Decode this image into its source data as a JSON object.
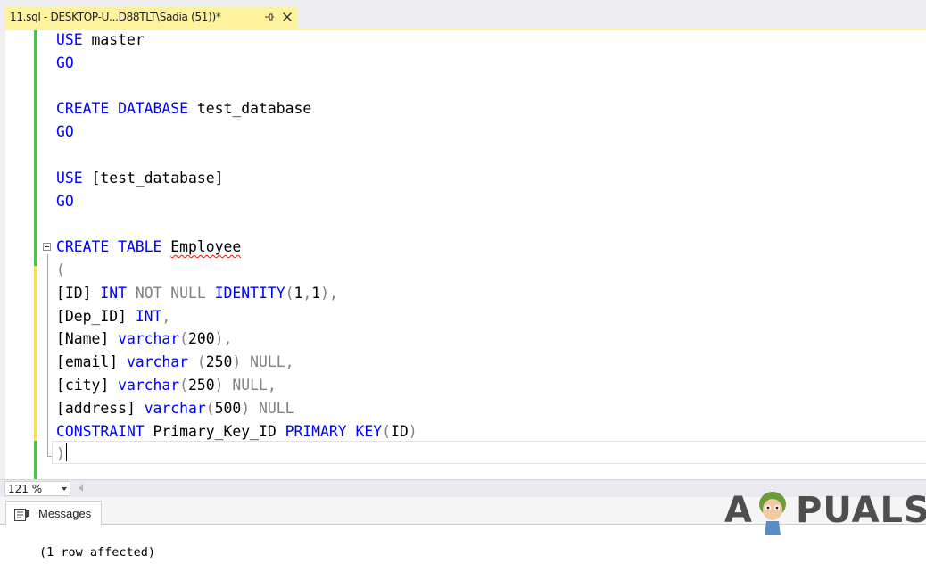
{
  "tab": {
    "title": "11.sql - DESKTOP-U...D88TLT\\Sadia (51))*",
    "pin_icon": "pin-icon",
    "close_icon": "close-icon"
  },
  "editor": {
    "lines": {
      "l1": {
        "t0": "USE",
        "t1": " master"
      },
      "l2": {
        "t0": "GO"
      },
      "l4": {
        "t0": "CREATE DATABASE",
        "t1": " test_database"
      },
      "l5": {
        "t0": "GO"
      },
      "l7": {
        "t0": "USE",
        "t1": " [test_database]"
      },
      "l8": {
        "t0": "GO"
      },
      "l10": {
        "t0": "CREATE TABLE",
        "t1": " ",
        "t2": "Employee"
      },
      "l11": {
        "t0": "("
      },
      "l12": {
        "t0": "[ID] ",
        "t1": "INT",
        "t2": " ",
        "t3": "NOT NULL",
        "t4": " ",
        "t5": "IDENTITY",
        "t6": "(",
        "t7": "1",
        "t8": ",",
        "t9": "1",
        "t10": "),"
      },
      "l13": {
        "t0": "[Dep_ID] ",
        "t1": "INT",
        "t2": ","
      },
      "l14": {
        "t0": "[Name] ",
        "t1": "varchar",
        "t2": "(",
        "t3": "200",
        "t4": "),"
      },
      "l15": {
        "t0": "[email] ",
        "t1": "varchar",
        "t2": " (",
        "t3": "250",
        "t4": ") ",
        "t5": "NULL",
        "t6": ","
      },
      "l16": {
        "t0": "[city] ",
        "t1": "varchar",
        "t2": "(",
        "t3": "250",
        "t4": ") ",
        "t5": "NULL",
        "t6": ","
      },
      "l17": {
        "t0": "[address] ",
        "t1": "varchar",
        "t2": "(",
        "t3": "500",
        "t4": ") ",
        "t5": "NULL"
      },
      "l18": {
        "t0": "CONSTRAINT",
        "t1": " Primary_Key_ID ",
        "t2": "PRIMARY KEY",
        "t3": "(",
        "t4": "ID",
        "t5": ")"
      },
      "l19": {
        "t0": ")"
      }
    }
  },
  "status": {
    "zoom": "121 %",
    "zoom_dropdown_icon": "chevron-down-icon",
    "scroll_left_icon": "scroll-left-icon"
  },
  "results": {
    "messages_tab": "Messages",
    "messages_icon": "messages-icon",
    "output": "(1 row affected)"
  },
  "watermark": {
    "text": "APPUALS"
  },
  "colors": {
    "keyword": "#0000ff",
    "operator": "#808080",
    "active_tab": "#fff29d",
    "saved_change": "#4fc14f",
    "unsaved_change": "#f5e25a"
  }
}
